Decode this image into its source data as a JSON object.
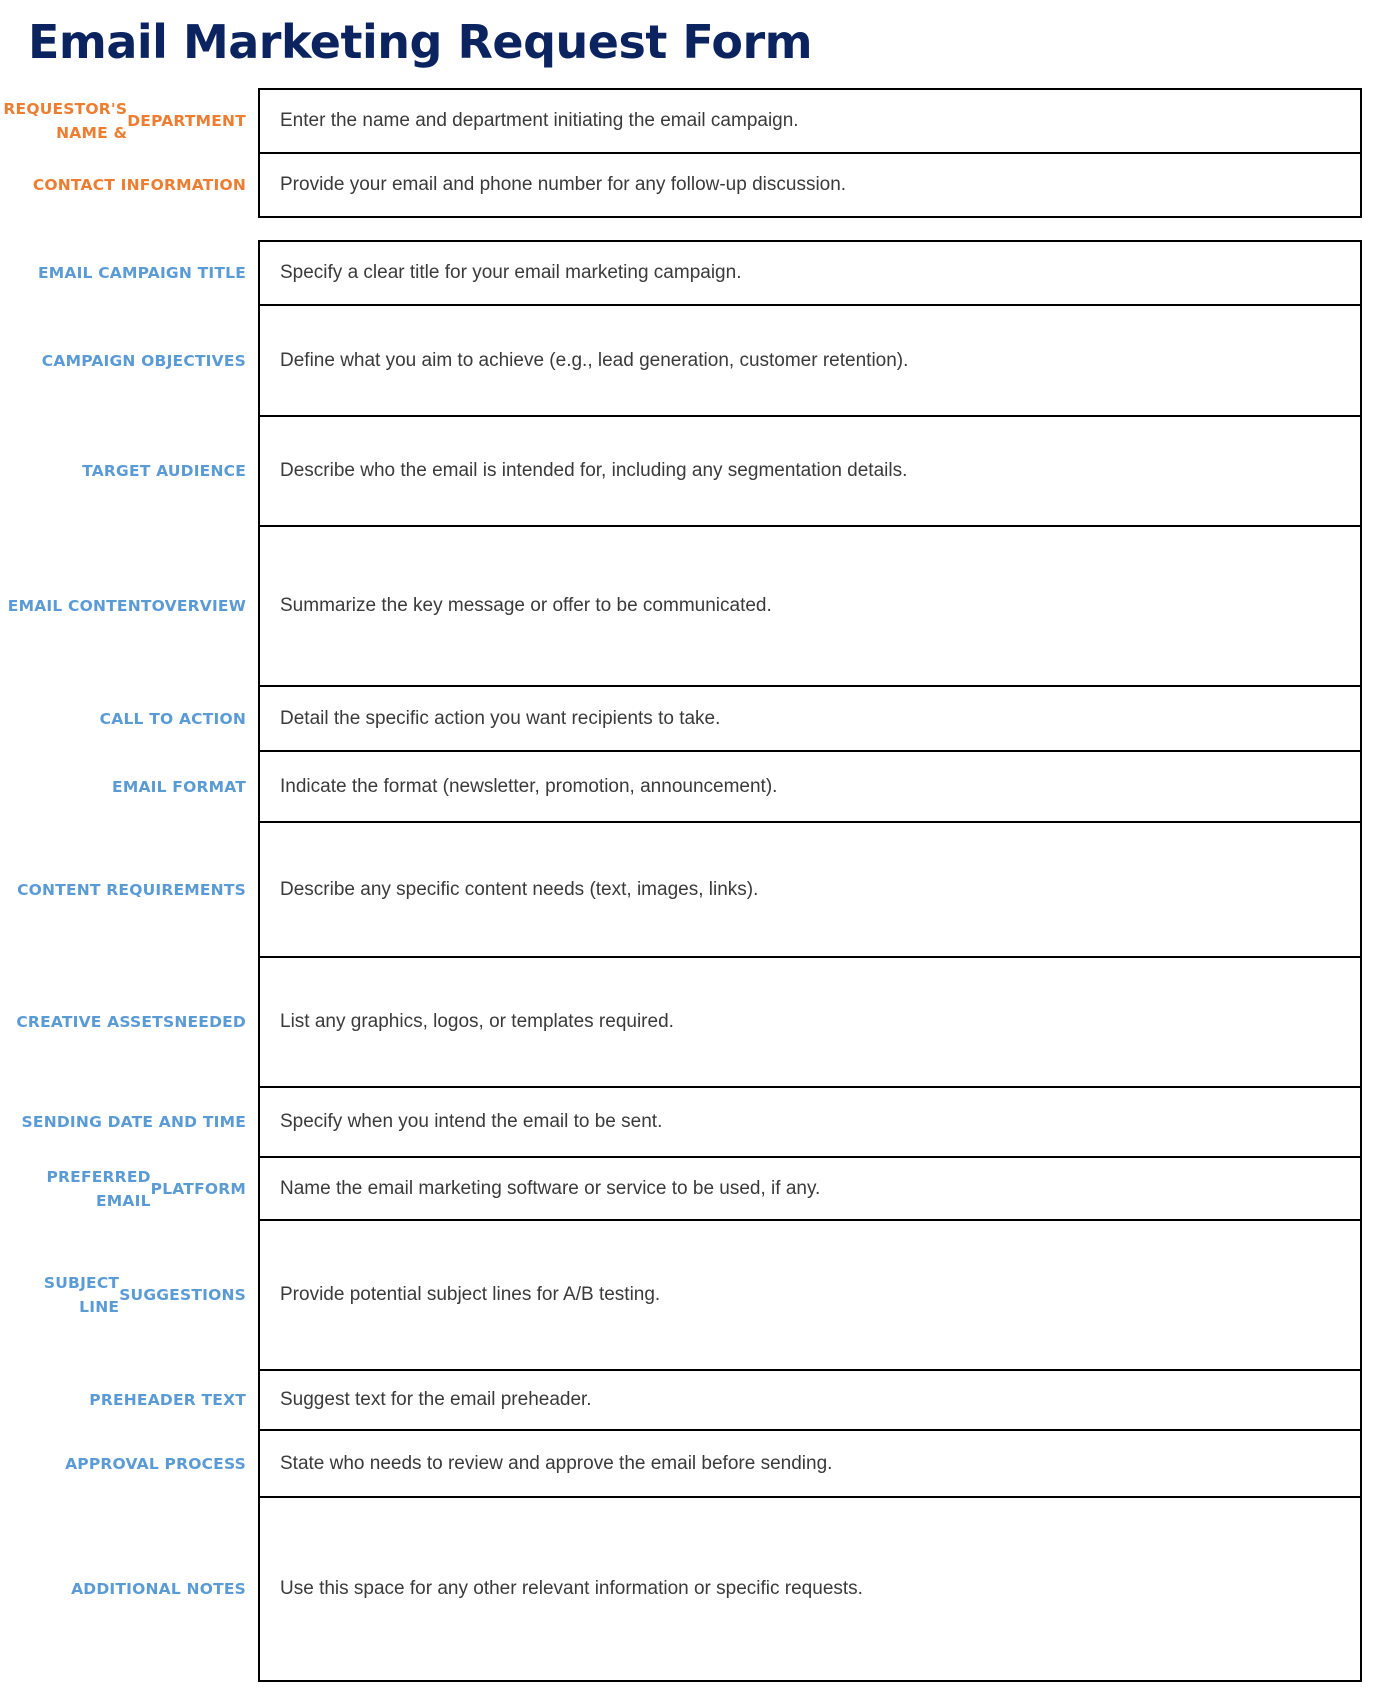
{
  "title": "Email Marketing Request Form",
  "colors": {
    "title": "#0b2460",
    "label_orange": "#ed7d31",
    "label_blue": "#5b9bd5",
    "field_text": "#3a3a3a",
    "border": "#000000"
  },
  "requestor_section": {
    "rows": [
      {
        "label_lines": [
          "REQUESTOR'S NAME &",
          "DEPARTMENT"
        ],
        "placeholder": "Enter the name and department initiating the email campaign."
      },
      {
        "label_lines": [
          "CONTACT INFORMATION"
        ],
        "placeholder": "Provide your email and phone number for any follow-up discussion."
      }
    ]
  },
  "campaign_section": {
    "rows": [
      {
        "label_lines": [
          "EMAIL CAMPAIGN TITLE"
        ],
        "placeholder": "Specify a clear title for your email marketing campaign."
      },
      {
        "label_lines": [
          "CAMPAIGN OBJECTIVES"
        ],
        "placeholder": "Define what you aim to achieve (e.g., lead generation, customer retention)."
      },
      {
        "label_lines": [
          "TARGET AUDIENCE"
        ],
        "placeholder": "Describe who the email is intended for, including any segmentation details."
      },
      {
        "label_lines": [
          "EMAIL CONTENT",
          "OVERVIEW"
        ],
        "placeholder": "Summarize the key message or offer to be communicated."
      },
      {
        "label_lines": [
          "CALL TO ACTION"
        ],
        "placeholder": "Detail the specific action you want recipients to take."
      },
      {
        "label_lines": [
          "EMAIL FORMAT"
        ],
        "placeholder": "Indicate the format (newsletter, promotion, announcement)."
      },
      {
        "label_lines": [
          "CONTENT REQUIREMENTS"
        ],
        "placeholder": "Describe any specific content needs (text, images, links)."
      },
      {
        "label_lines": [
          "CREATIVE ASSETS",
          "NEEDED"
        ],
        "placeholder": "List any graphics, logos, or templates required."
      },
      {
        "label_lines": [
          "SENDING DATE AND TIME"
        ],
        "placeholder": "Specify when you intend the email to be sent."
      },
      {
        "label_lines": [
          "PREFERRED EMAIL",
          "PLATFORM"
        ],
        "placeholder": "Name the email marketing software or service to be used, if any."
      },
      {
        "label_lines": [
          "SUBJECT LINE",
          "SUGGESTIONS"
        ],
        "placeholder": "Provide potential subject lines for A/B testing."
      },
      {
        "label_lines": [
          "PREHEADER TEXT"
        ],
        "placeholder": "Suggest text for the email preheader."
      },
      {
        "label_lines": [
          "APPROVAL PROCESS"
        ],
        "placeholder": "State who needs to review and approve the email before sending."
      },
      {
        "label_lines": [
          "ADDITIONAL NOTES"
        ],
        "placeholder": "Use this space for any other relevant information or specific requests."
      }
    ]
  }
}
